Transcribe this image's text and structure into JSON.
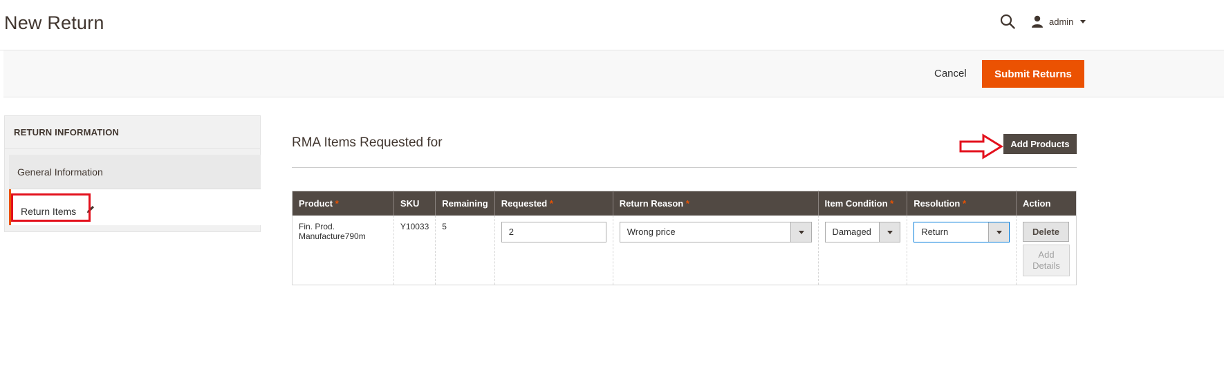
{
  "header": {
    "title": "New Return",
    "user_name": "admin"
  },
  "actions": {
    "cancel_label": "Cancel",
    "submit_label": "Submit Returns"
  },
  "sidebar": {
    "title": "RETURN INFORMATION",
    "items": [
      {
        "label": "General Information"
      },
      {
        "label": "Return Items"
      }
    ]
  },
  "main": {
    "section_title": "RMA Items Requested for",
    "add_products_label": "Add Products",
    "table": {
      "columns": [
        {
          "label": "Product",
          "required": "*"
        },
        {
          "label": "SKU",
          "required": ""
        },
        {
          "label": "Remaining",
          "required": ""
        },
        {
          "label": "Requested",
          "required": "*"
        },
        {
          "label": "Return Reason",
          "required": "*"
        },
        {
          "label": "Item Condition",
          "required": "*"
        },
        {
          "label": "Resolution",
          "required": "*"
        },
        {
          "label": "Action",
          "required": ""
        }
      ],
      "rows": [
        {
          "product_line1": "Fin. Prod.",
          "product_line2": "Manufacture790m",
          "sku": "Y10033",
          "remaining": "5",
          "requested": "2",
          "return_reason": "Wrong price",
          "item_condition": "Damaged",
          "resolution": "Return",
          "delete_label": "Delete",
          "add_details_line1": "Add",
          "add_details_line2": "Details"
        }
      ]
    }
  },
  "colors": {
    "accent": "#eb5202",
    "header_dark": "#514943",
    "annotation_red": "#e3101c"
  },
  "icons": {
    "search": "search-icon",
    "user": "user-icon",
    "edit": "pencil-icon"
  }
}
